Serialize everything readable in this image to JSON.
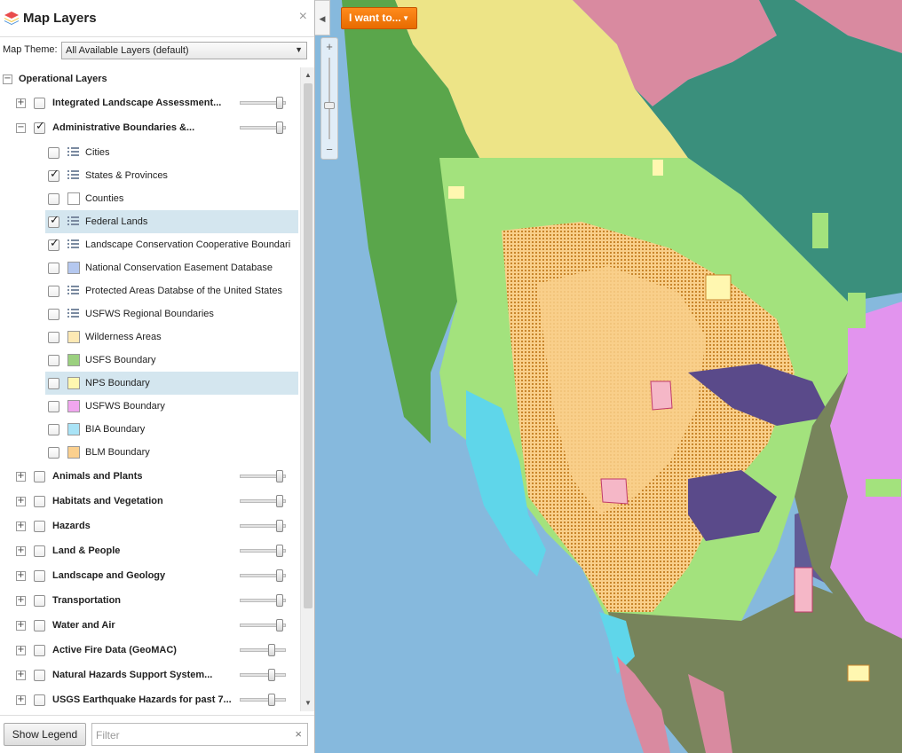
{
  "panel": {
    "title": "Map Layers",
    "close_symbol": "×"
  },
  "theme": {
    "label": "Map Theme:",
    "selected": "All Available Layers (default)"
  },
  "tree": {
    "root_label": "Operational Layers",
    "groups_top": [
      {
        "label": "Integrated Landscape Assessment...",
        "checked": false,
        "expanded": false,
        "opacity": 1.0
      },
      {
        "label": "Administrative Boundaries &...",
        "checked": true,
        "expanded": true,
        "opacity": 1.0
      }
    ],
    "admin_layers": [
      {
        "label": "Cities",
        "checked": false,
        "legend": "list-icon",
        "selected": false
      },
      {
        "label": "States & Provinces",
        "checked": true,
        "legend": "list-icon",
        "selected": false
      },
      {
        "label": "Counties",
        "checked": false,
        "legend": "swatch",
        "color": "#ffffff",
        "selected": false
      },
      {
        "label": "Federal Lands",
        "checked": true,
        "legend": "list-icon",
        "selected": true
      },
      {
        "label": "Landscape Conservation Cooperative Boundari",
        "checked": true,
        "legend": "list-icon",
        "selected": false
      },
      {
        "label": "National Conservation Easement Database",
        "checked": false,
        "legend": "swatch",
        "color": "#b5c8ef",
        "selected": false
      },
      {
        "label": "Protected Areas Databse of the United States",
        "checked": false,
        "legend": "list-icon",
        "selected": false
      },
      {
        "label": "USFWS Regional Boundaries",
        "checked": false,
        "legend": "list-icon",
        "selected": false
      },
      {
        "label": "Wilderness Areas",
        "checked": false,
        "legend": "swatch",
        "color": "#fde9b4",
        "selected": false
      },
      {
        "label": "USFS Boundary",
        "checked": false,
        "legend": "swatch",
        "color": "#9bd07f",
        "selected": false
      },
      {
        "label": "NPS Boundary",
        "checked": false,
        "legend": "swatch",
        "color": "#fff7b0",
        "selected": true
      },
      {
        "label": "USFWS Boundary",
        "checked": false,
        "legend": "swatch",
        "color": "#f0a6ee",
        "selected": false
      },
      {
        "label": "BIA Boundary",
        "checked": false,
        "legend": "swatch",
        "color": "#a9e3f6",
        "selected": false
      },
      {
        "label": "BLM Boundary",
        "checked": false,
        "legend": "swatch",
        "color": "#fbd08e",
        "selected": false
      }
    ],
    "groups_bottom": [
      {
        "label": "Animals and Plants",
        "checked": false,
        "opacity": 1.0
      },
      {
        "label": "Habitats and Vegetation",
        "checked": false,
        "opacity": 1.0
      },
      {
        "label": "Hazards",
        "checked": false,
        "opacity": 1.0
      },
      {
        "label": "Land & People",
        "checked": false,
        "opacity": 1.0
      },
      {
        "label": "Landscape and Geology",
        "checked": false,
        "opacity": 1.0
      },
      {
        "label": "Transportation",
        "checked": false,
        "opacity": 1.0
      },
      {
        "label": "Water and Air",
        "checked": false,
        "opacity": 1.0
      },
      {
        "label": "Active Fire Data (GeoMAC)",
        "checked": false,
        "opacity": 0.8
      },
      {
        "label": "Natural Hazards Support System...",
        "checked": false,
        "opacity": 0.8
      },
      {
        "label": "USGS Earthquake Hazards for past 7...",
        "checked": false,
        "opacity": 0.8
      }
    ]
  },
  "footer": {
    "legend_button": "Show Legend",
    "filter_placeholder": "Filter",
    "filter_clear": "×"
  },
  "map": {
    "iwant_label": "I want to...",
    "zoom_in": "+",
    "zoom_out": "−",
    "colors": {
      "ocean": "#86b9dd",
      "canada_yellow": "#ede487",
      "forest_green": "#5aa64b",
      "teal": "#3a8f7c",
      "pink": "#d98aa0",
      "light_green": "#a3e27d",
      "brown": "#c8852b",
      "tan": "#f9cf8a",
      "purple": "#5a4a8a",
      "olive": "#77845b",
      "cyan": "#5fd6ea",
      "magenta": "#e294ee"
    }
  }
}
